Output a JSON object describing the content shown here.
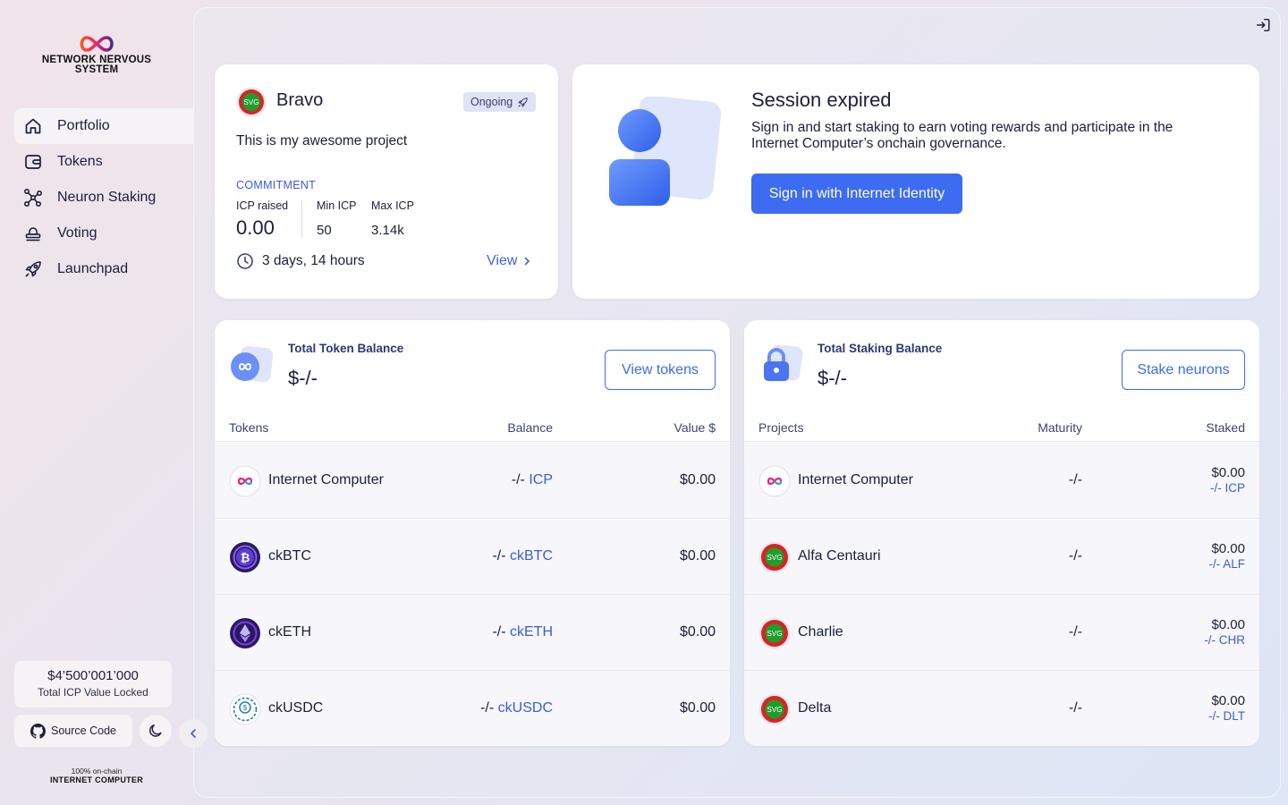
{
  "brand": {
    "line1": "NETWORK NERVOUS",
    "line2": "SYSTEM"
  },
  "nav": [
    {
      "label": "Portfolio",
      "icon": "home-icon",
      "active": true
    },
    {
      "label": "Tokens",
      "icon": "wallet-icon"
    },
    {
      "label": "Neuron Staking",
      "icon": "neurons-icon"
    },
    {
      "label": "Voting",
      "icon": "voting-icon"
    },
    {
      "label": "Launchpad",
      "icon": "rocket-icon"
    }
  ],
  "tvl": {
    "value": "$4’500’001’000",
    "label": "Total ICP Value Locked"
  },
  "source_code": "Source Code",
  "footer": {
    "top": "100% on-chain",
    "bottom": "INTERNET COMPUTER"
  },
  "project": {
    "name": "Bravo",
    "status": "Ongoing",
    "description": "This is my awesome project",
    "commitment_label": "COMMITMENT",
    "icp_raised_label": "ICP raised",
    "icp_raised": "0.00",
    "min_label": "Min ICP",
    "min_value": "50",
    "max_label": "Max ICP",
    "max_value": "3.14k",
    "time_left": "3 days, 14 hours",
    "view_label": "View",
    "logo_text": "SVG"
  },
  "session": {
    "title": "Session expired",
    "text": "Sign in and start staking to earn voting rewards and participate in the Internet Computer’s onchain governance.",
    "button": "Sign in with Internet Identity"
  },
  "tokens_card": {
    "title": "Total Token Balance",
    "value": "$-/-",
    "button": "View tokens",
    "headers": {
      "name": "Tokens",
      "balance": "Balance",
      "value": "Value $"
    },
    "rows": [
      {
        "name": "Internet Computer",
        "balance": "-/-",
        "symbol": "ICP",
        "value": "$0.00",
        "icon": "icp-logo-icon"
      },
      {
        "name": "ckBTC",
        "balance": "-/-",
        "symbol": "ckBTC",
        "value": "$0.00",
        "icon": "ckbtc-logo-icon"
      },
      {
        "name": "ckETH",
        "balance": "-/-",
        "symbol": "ckETH",
        "value": "$0.00",
        "icon": "cketh-logo-icon"
      },
      {
        "name": "ckUSDC",
        "balance": "-/-",
        "symbol": "ckUSDC",
        "value": "$0.00",
        "icon": "ckusdc-logo-icon"
      }
    ]
  },
  "staking_card": {
    "title": "Total Staking Balance",
    "value": "$-/-",
    "button": "Stake neurons",
    "headers": {
      "name": "Projects",
      "maturity": "Maturity",
      "staked": "Staked"
    },
    "rows": [
      {
        "name": "Internet Computer",
        "maturity": "-/-",
        "staked": "$0.00",
        "sub": "-/- ICP",
        "icon": "icp-logo-icon"
      },
      {
        "name": "Alfa Centauri",
        "maturity": "-/-",
        "staked": "$0.00",
        "sub": "-/- ALF",
        "icon": "svg-logo-icon"
      },
      {
        "name": "Charlie",
        "maturity": "-/-",
        "staked": "$0.00",
        "sub": "-/- CHR",
        "icon": "svg-logo-icon"
      },
      {
        "name": "Delta",
        "maturity": "-/-",
        "staked": "$0.00",
        "sub": "-/- DLT",
        "icon": "svg-logo-icon"
      }
    ]
  },
  "colors": {
    "accent": "#3d6bf2",
    "link": "#3b5bdb",
    "card": "#ffffff"
  }
}
